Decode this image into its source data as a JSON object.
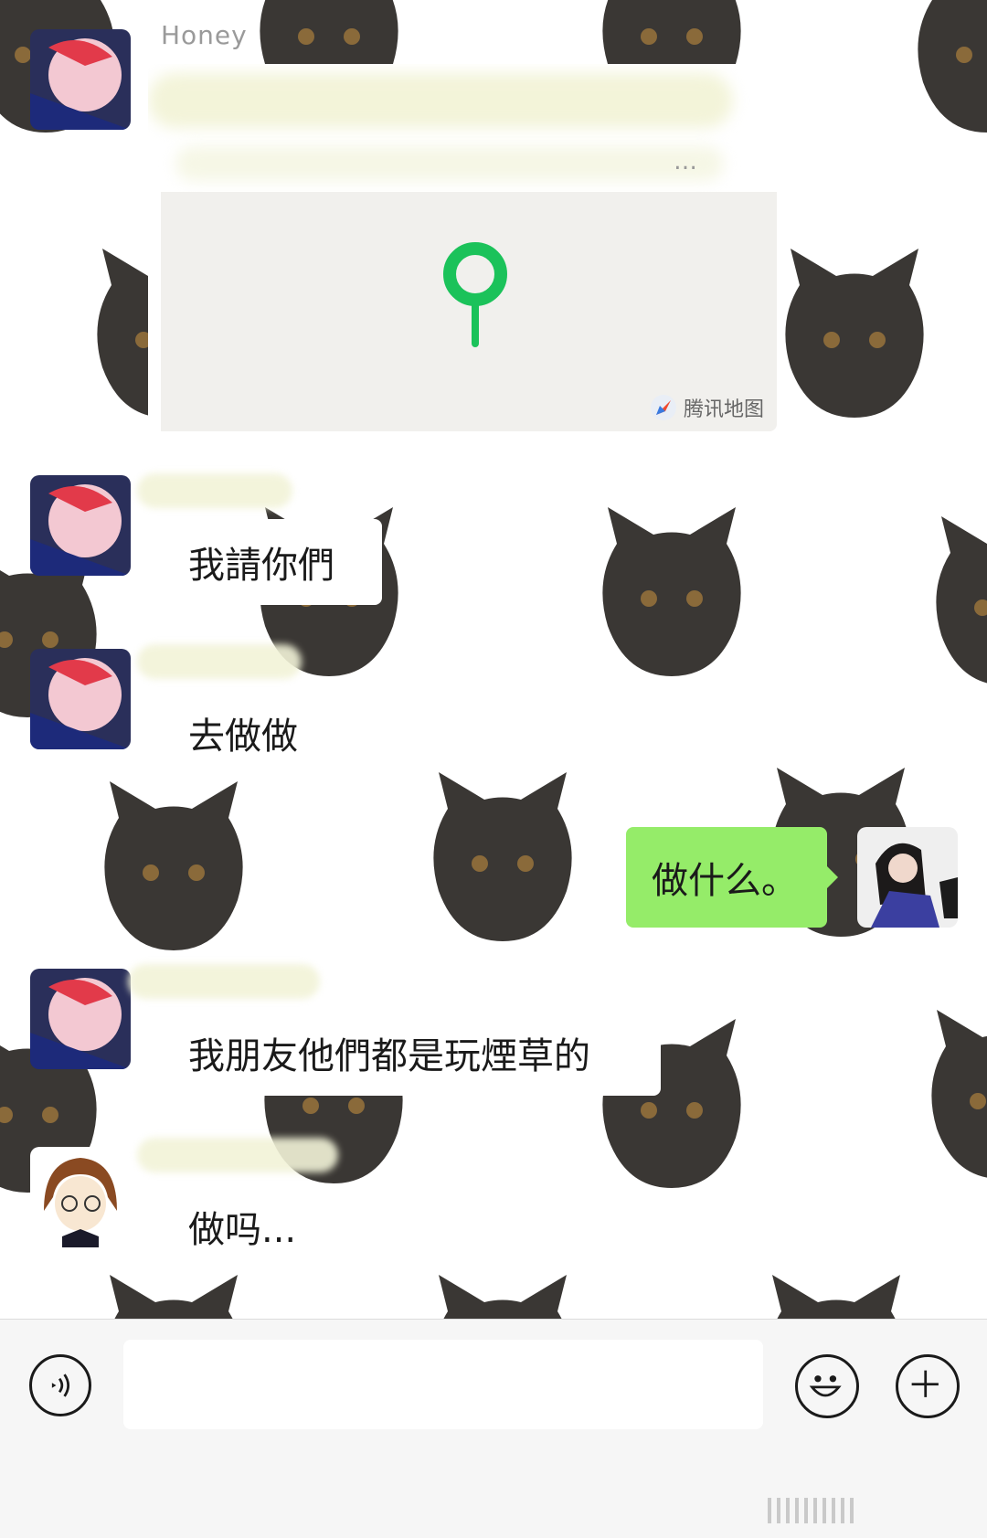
{
  "chat": {
    "messages": [
      {
        "sender": "Honey",
        "type": "location",
        "map_brand": "腾讯地图"
      },
      {
        "sender": "",
        "type": "text",
        "text": "我請你們"
      },
      {
        "sender": "",
        "type": "text",
        "text": "去做做"
      },
      {
        "sender": "me",
        "type": "text",
        "text": "做什么。"
      },
      {
        "sender": "",
        "type": "text",
        "text": "我朋友他們都是玩煙草的"
      },
      {
        "sender": "",
        "type": "text",
        "text": "做吗..."
      }
    ]
  },
  "location": {
    "dots": "…",
    "map_brand": "腾讯地图"
  },
  "input_bar": {
    "placeholder": "",
    "value": ""
  },
  "colors": {
    "bubble_self": "#95ec69",
    "bubble_other": "#ffffff",
    "pin": "#1bc25a",
    "cat": "#3a3734"
  },
  "icons": [
    "voice-icon",
    "emoji-icon",
    "plus-icon",
    "location-pin-icon"
  ]
}
